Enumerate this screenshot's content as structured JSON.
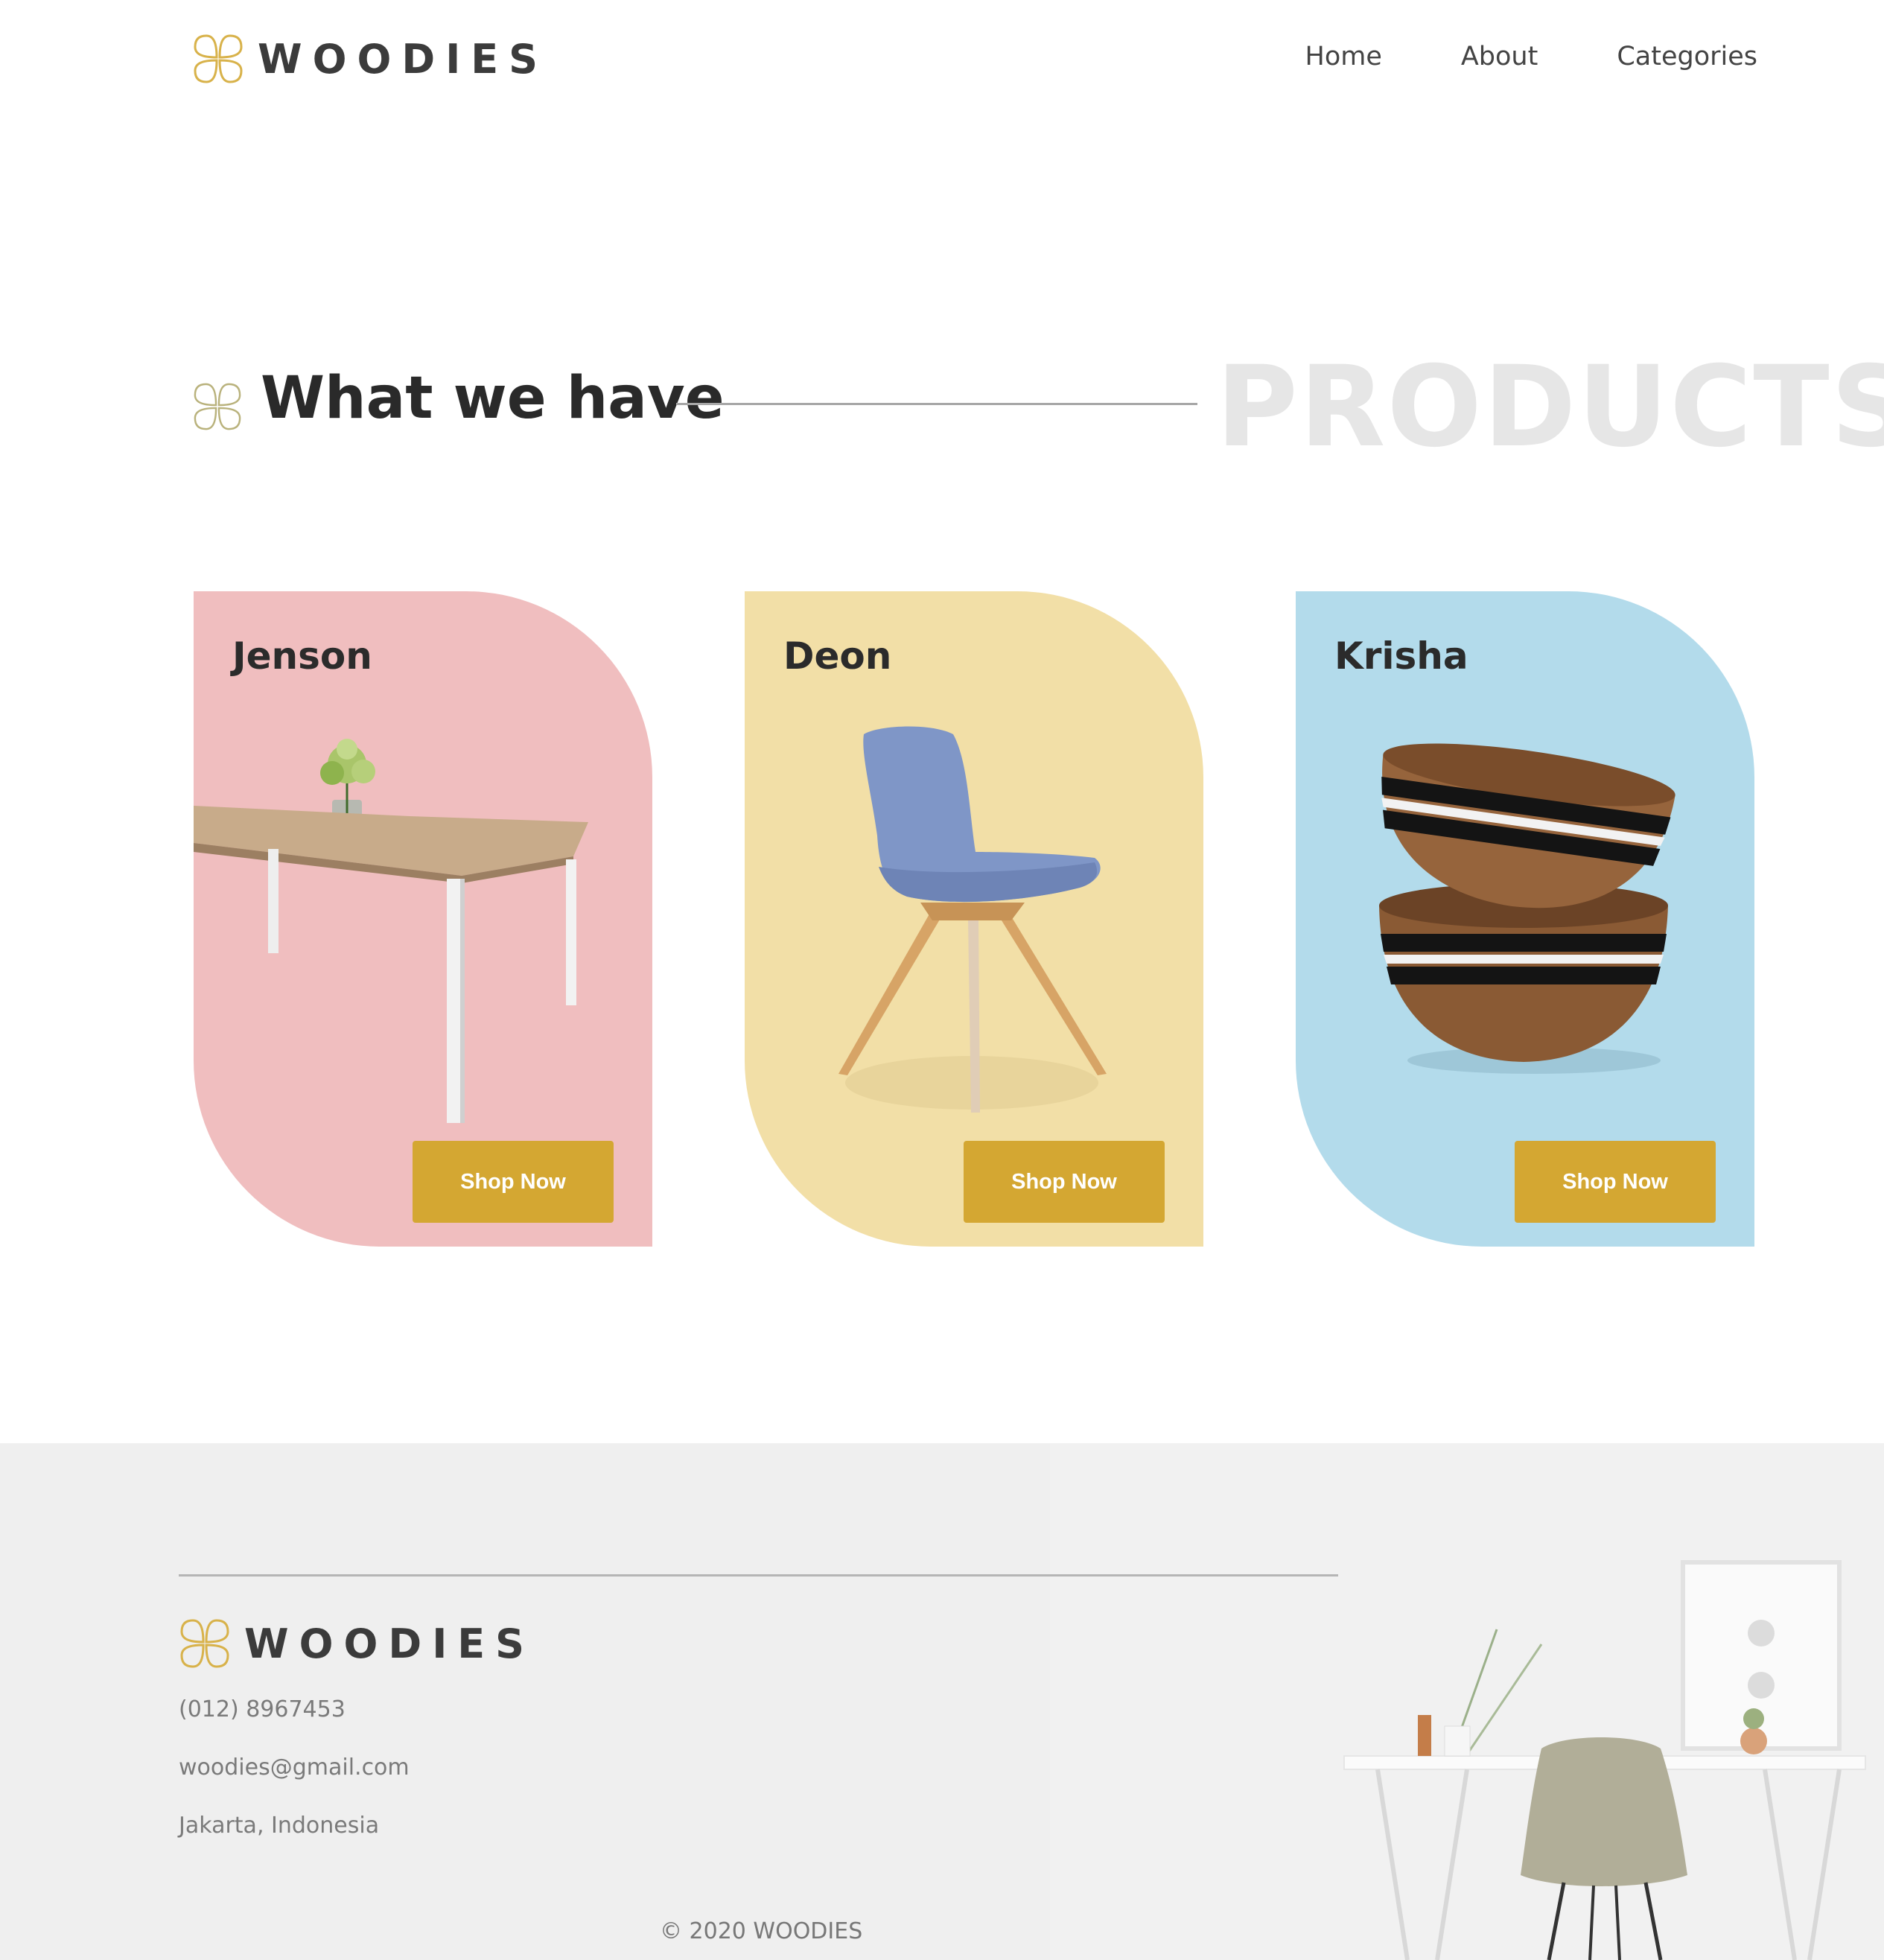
{
  "brand": {
    "name": "WOODIES",
    "accent_color": "#d4a732",
    "logo_icon": "four-petal-flower-icon"
  },
  "nav": {
    "items": [
      "Home",
      "About",
      "Categories"
    ]
  },
  "section": {
    "title": "What we have",
    "watermark": "PRODUCTS",
    "icon": "four-petal-flower-icon"
  },
  "products": [
    {
      "name": "Jenson",
      "button": "Shop Now",
      "bg_color": "#f0bebf",
      "image": "wooden-table-with-flower-vase"
    },
    {
      "name": "Deon",
      "button": "Shop Now",
      "bg_color": "#f2dfa7",
      "image": "blue-chair-wooden-legs"
    },
    {
      "name": "Krisha",
      "button": "Shop Now",
      "bg_color": "#b3dbeb",
      "image": "stacked-striped-wooden-bowls"
    }
  ],
  "footer": {
    "brand": "WOODIES",
    "phone": "(012) 8967453",
    "email": "woodies@gmail.com",
    "address": "Jakarta, Indonesia",
    "copyright": "© 2020 WOODIES",
    "background_image": "desk-and-chair-interior"
  }
}
